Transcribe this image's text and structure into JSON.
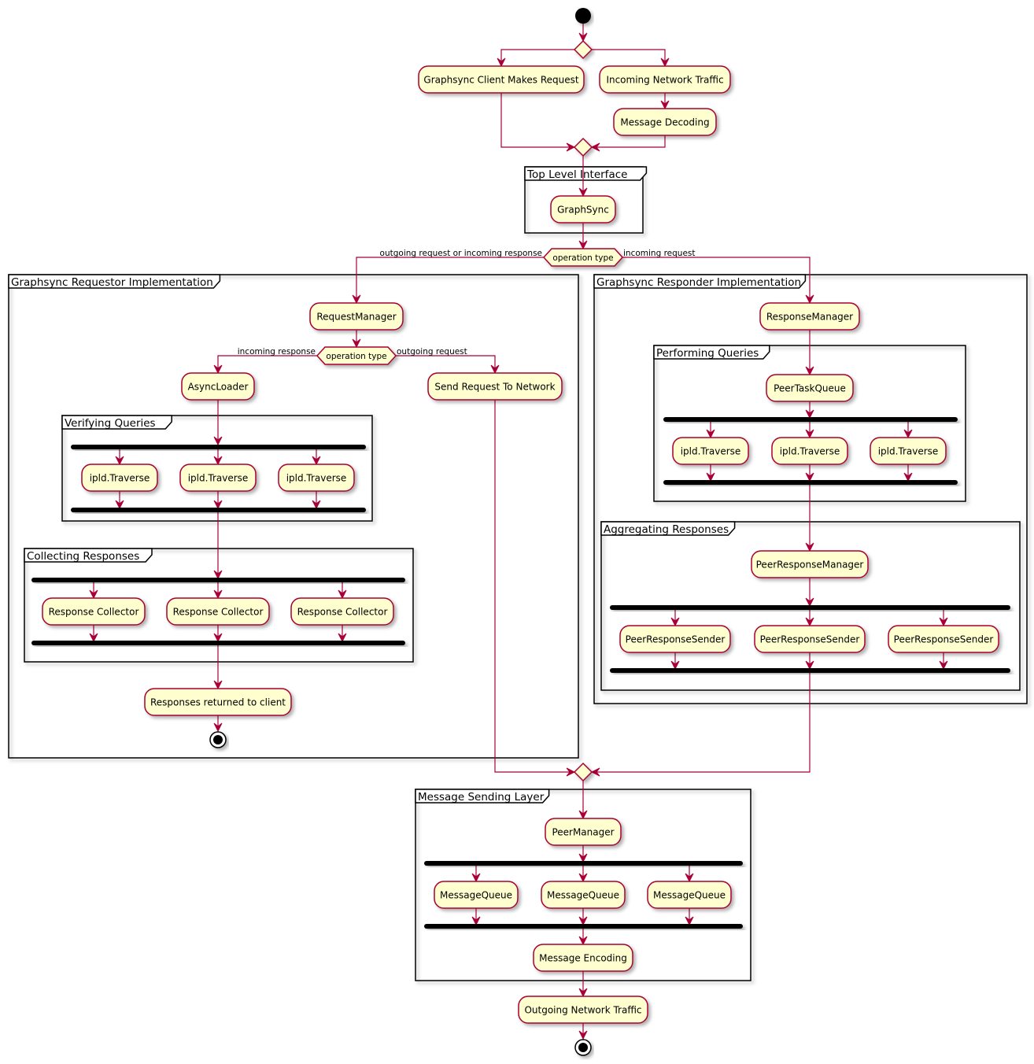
{
  "diagram": {
    "type": "activity",
    "colors": {
      "node_fill": "#FEFECE",
      "node_border": "#A80036",
      "edge": "#A80036",
      "frame": "#000000"
    },
    "top": {
      "client_request": "Graphsync Client Makes Request",
      "incoming_traffic": "Incoming Network Traffic",
      "message_decoding": "Message Decoding"
    },
    "top_level": {
      "title": "Top Level Interface",
      "graphsync": "GraphSync"
    },
    "split": {
      "label": "operation type",
      "left_label": "outgoing request or incoming response",
      "right_label": "incoming request"
    },
    "requestor": {
      "title": "Graphsync Requestor Implementation",
      "request_manager": "RequestManager",
      "split_label": "operation type",
      "left_label": "incoming response",
      "right_label": "outgoing request",
      "async_loader": "AsyncLoader",
      "send_request": "Send Request To Network",
      "verifying": {
        "title": "Verifying Queries",
        "items": [
          "ipld.Traverse",
          "ipld.Traverse",
          "ipld.Traverse"
        ]
      },
      "collecting": {
        "title": "Collecting Responses",
        "items": [
          "Response Collector",
          "Response Collector",
          "Response Collector"
        ]
      },
      "returned": "Responses returned to client"
    },
    "responder": {
      "title": "Graphsync Responder Implementation",
      "response_manager": "ResponseManager",
      "performing": {
        "title": "Performing Queries",
        "queue": "PeerTaskQueue",
        "items": [
          "ipld.Traverse",
          "ipld.Traverse",
          "ipld.Traverse"
        ]
      },
      "aggregating": {
        "title": "Aggregating Responses",
        "manager": "PeerResponseManager",
        "items": [
          "PeerResponseSender",
          "PeerResponseSender",
          "PeerResponseSender"
        ]
      }
    },
    "sending": {
      "title": "Message Sending Layer",
      "peer_manager": "PeerManager",
      "items": [
        "MessageQueue",
        "MessageQueue",
        "MessageQueue"
      ],
      "encoding": "Message Encoding"
    },
    "outgoing_traffic": "Outgoing Network Traffic"
  }
}
